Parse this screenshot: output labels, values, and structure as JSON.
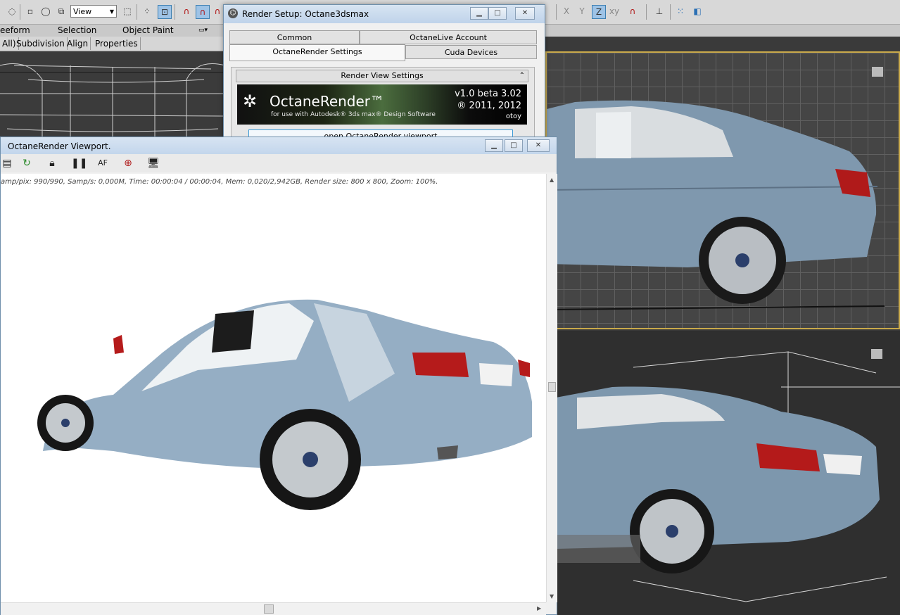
{
  "main_toolbar": {
    "view_select": "View"
  },
  "ribbon": {
    "tabs": [
      "eeform",
      "Selection",
      "Object Paint"
    ],
    "sub_tabs": [
      "All)",
      "Subdivision",
      "Align",
      "Properties"
    ]
  },
  "render_setup": {
    "title": "Render Setup: Octane3dsmax",
    "tabs_row1": [
      "Common",
      "OctaneLive Account"
    ],
    "tabs_row2": [
      "OctaneRender Settings",
      "Cuda Devices"
    ],
    "rollout_title": "Render View Settings",
    "banner": {
      "product": "OctaneRender™",
      "subtitle": "for use with Autodesk® 3ds max® Design Software",
      "version": "v1.0 beta 3.02",
      "years": "® 2011, 2012",
      "brand": "otoy"
    },
    "open_viewport_button": "open OctaneRender viewport"
  },
  "octane_viewport": {
    "title": "OctaneRender Viewport.",
    "status": "amp/pix: 990/990,   Samp/s: 0,000M,   Time: 00:00:04 / 00:00:04,   Mem: 0,020/2,942GB,   Render size: 800 x 800,   Zoom: 100%."
  },
  "colors": {
    "accent_viewport_border": "#c9a94a",
    "titlebar": "#c3d6ec",
    "car_body": "#8fa7bd"
  }
}
